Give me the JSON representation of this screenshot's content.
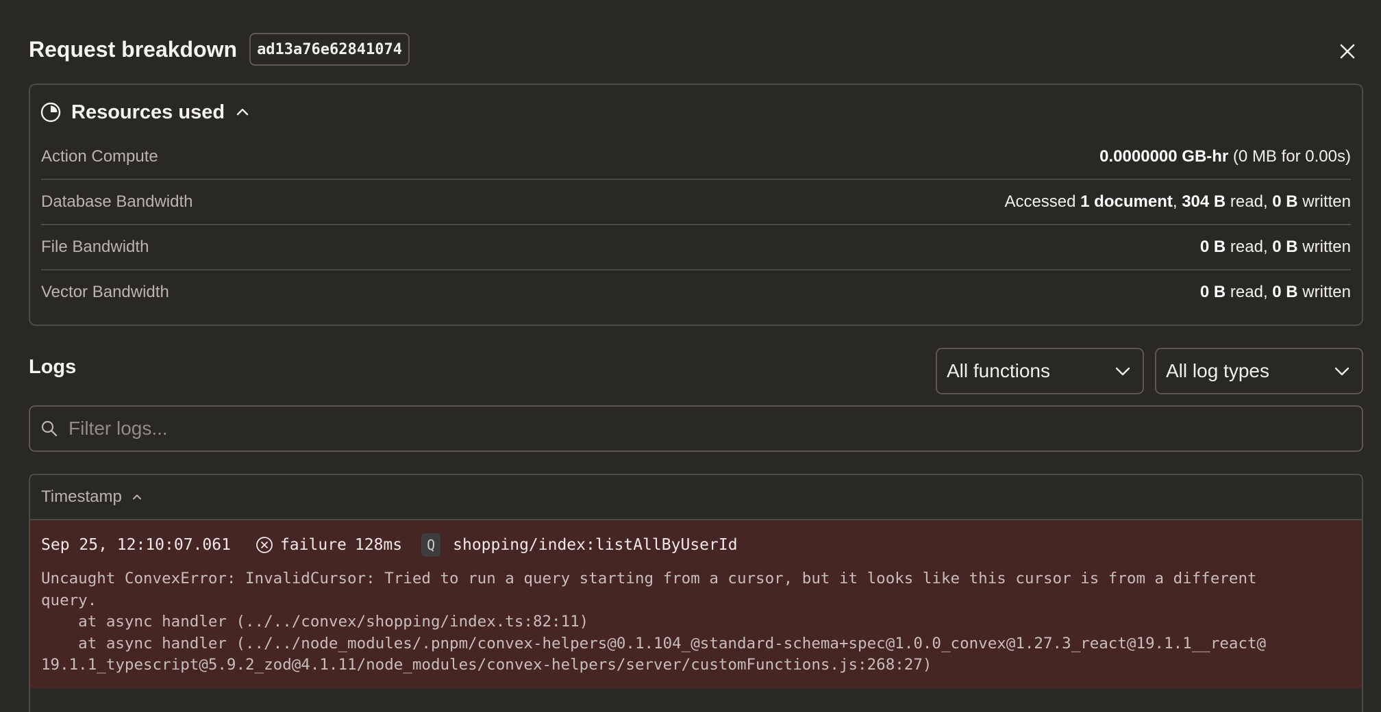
{
  "header": {
    "title": "Request breakdown",
    "request_id": "ad13a76e62841074"
  },
  "resources": {
    "title": "Resources used",
    "rows": {
      "action_compute": {
        "label": "Action Compute",
        "value_bold": "0.0000000 GB-hr",
        "value_rest": " (0 MB for 0.00s)"
      },
      "database_bandwidth": {
        "label": "Database Bandwidth",
        "prefix": "Accessed ",
        "documents": "1 document",
        "sep": ", ",
        "read": "304 B",
        "read_text": " read, ",
        "written": "0 B",
        "written_text": " written"
      },
      "file_bandwidth": {
        "label": "File Bandwidth",
        "read": "0 B",
        "read_text": " read, ",
        "written": "0 B",
        "written_text": " written"
      },
      "vector_bandwidth": {
        "label": "Vector Bandwidth",
        "read": "0 B",
        "read_text": " read, ",
        "written": "0 B",
        "written_text": " written"
      }
    }
  },
  "logs": {
    "title": "Logs",
    "function_filter": "All functions",
    "type_filter": "All log types",
    "search_placeholder": "Filter logs...",
    "column_header": "Timestamp",
    "entries": [
      {
        "timestamp": "Sep 25, 12:10:07.061",
        "status": "failure",
        "duration": "128ms",
        "kind": "Q",
        "function": "shopping/index:listAllByUserId",
        "message": "Uncaught ConvexError: InvalidCursor: Tried to run a query starting from a cursor, but it looks like this cursor is from a different\nquery.\n    at async handler (../../convex/shopping/index.ts:82:11)\n    at async handler (../../node_modules/.pnpm/convex-helpers@0.1.104_@standard-schema+spec@1.0.0_convex@1.27.3_react@19.1.1__react@\n19.1.1_typescript@5.9.2_zod@4.1.11/node_modules/convex-helpers/server/customFunctions.js:268:27)"
      }
    ]
  },
  "colors": {
    "background": "#2a2825",
    "failure_row": "#462624",
    "border": "#4c4a46"
  }
}
